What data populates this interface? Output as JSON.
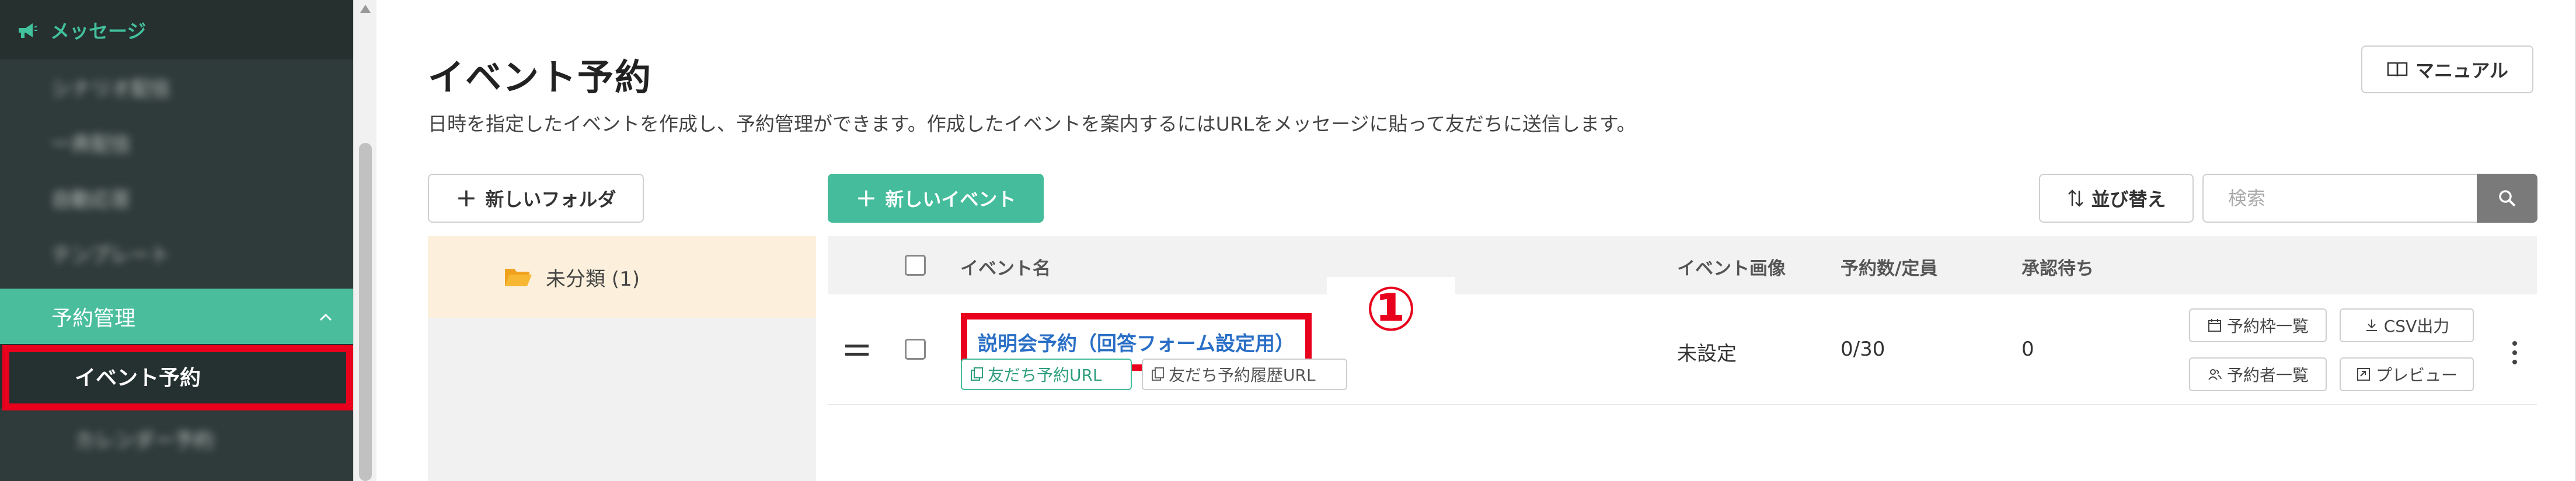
{
  "sidebar": {
    "header_label": "メッセージ",
    "blurred_items": [
      "シナリオ配信",
      "一斉配信",
      "自動応答",
      "テンプレート"
    ],
    "section_label": "予約管理",
    "active_item": "イベント予約",
    "blurred_after": "カレンダー予約"
  },
  "page": {
    "title": "イベント予約",
    "description": "日時を指定したイベントを作成し、予約管理ができます。作成したイベントを案内するにはURLをメッセージに貼って友だちに送信します。",
    "manual_label": "マニュアル"
  },
  "toolbar": {
    "new_folder": "新しいフォルダ",
    "new_event": "新しいイベント",
    "sort": "並び替え",
    "search_placeholder": "検索"
  },
  "folders": [
    {
      "label": "未分類 (1)"
    }
  ],
  "table": {
    "headers": {
      "name": "イベント名",
      "image": "イベント画像",
      "count": "予約数/定員",
      "pending": "承認待ち"
    },
    "rows": [
      {
        "name": "説明会予約（回答フォーム設定用）",
        "tag_url": "友だち予約URL",
        "tag_history": "友だち予約履歴URL",
        "image": "未設定",
        "count": "0/30",
        "pending": "0",
        "actions": {
          "slots": "予約枠一覧",
          "csv": "CSV出力",
          "reservers": "予約者一覧",
          "preview": "プレビュー"
        }
      }
    ]
  },
  "annotation": {
    "marker": "①",
    "color": "#e8001c"
  },
  "colors": {
    "accent": "#45bc9b",
    "link": "#2a6fc6",
    "sidebar": "#2f3b3a"
  }
}
